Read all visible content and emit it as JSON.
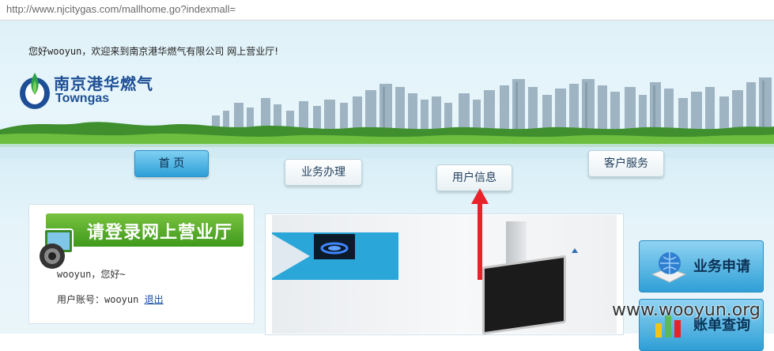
{
  "browser": {
    "url": "http://www.njcitygas.com/mallhome.go?indexmall="
  },
  "header": {
    "welcome_prefix": "您好",
    "welcome_user": "wooyun",
    "welcome_suffix": "，欢迎来到南京港华燃气有限公司 网上营业厅!",
    "logo_cn": "南京港华燃气",
    "logo_en": "Towngas"
  },
  "nav": {
    "items": [
      {
        "label": "首 页",
        "active": true
      },
      {
        "label": "业务办理",
        "active": false
      },
      {
        "label": "用户信息",
        "active": false
      },
      {
        "label": "客户服务",
        "active": false
      }
    ]
  },
  "login": {
    "banner": "请登录网上营业厅",
    "greeting": "wooyun，您好~",
    "account_label": "用户账号：wooyun",
    "logout": "退出"
  },
  "services": {
    "items": [
      {
        "label": "业务申请"
      },
      {
        "label": "账单查询"
      }
    ]
  },
  "watermark": "www.wooyun.org",
  "colors": {
    "accent_blue": "#2d9fd8",
    "login_green": "#5aaf2a",
    "arrow_red": "#e8212b"
  }
}
